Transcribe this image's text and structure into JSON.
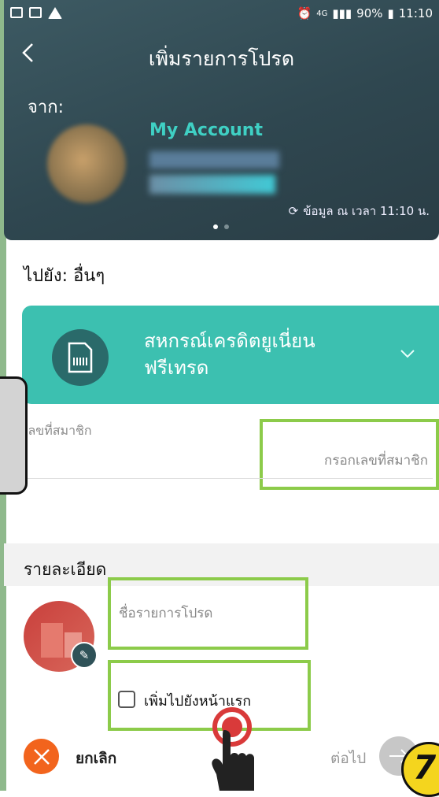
{
  "statusbar": {
    "network": "4G",
    "battery": "90%",
    "time": "11:10"
  },
  "header": {
    "back_icon": "chevron-left-icon",
    "title": "เพิ่มรายการโปรด",
    "from_label": "จาก:",
    "account_name": "My Account",
    "data_time": "ข้อมูล ณ เวลา 11:10 น."
  },
  "destination": {
    "to_label": "ไปยัง: อื่นๆ",
    "bank_name_line1": "สหกรณ์เครดิตยูเนี่ยน",
    "bank_name_line2": "ฟรีเทรด"
  },
  "member": {
    "label": "เลขที่สมาชิก",
    "placeholder": "กรอกเลขที่สมาชิก"
  },
  "details": {
    "label": "รายละเอียด",
    "name_placeholder": "ชื่อรายการโปรด",
    "add_home_label": "เพิ่มไปยังหน้าแรก"
  },
  "footer": {
    "cancel_label": "ยกเลิก",
    "next_label": "ต่อไป"
  },
  "annotation": {
    "step_number": "7"
  },
  "colors": {
    "accent": "#3cc0b0",
    "highlight": "#8ccb4a",
    "cancel": "#f2641d"
  }
}
